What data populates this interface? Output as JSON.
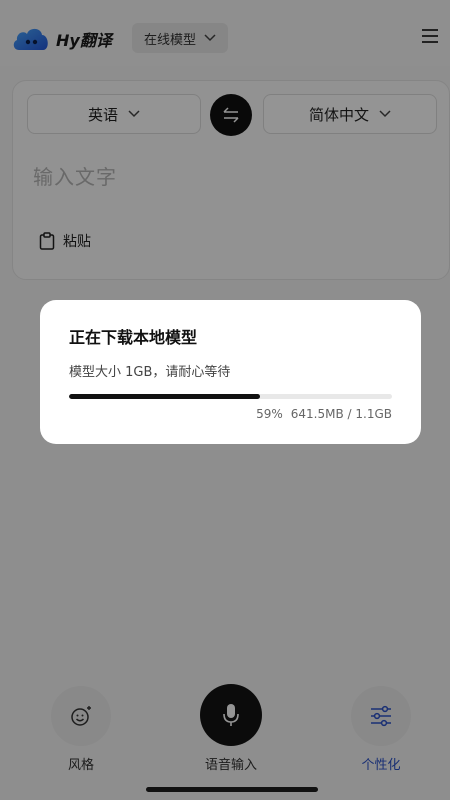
{
  "header": {
    "brand": "Hy翻译",
    "model_selector": "在线模型",
    "icons": {
      "logo": "cloud-logo-icon",
      "menu": "hamburger-menu-icon",
      "dropdown": "chevron-down-icon"
    }
  },
  "translator": {
    "source_lang": "英语",
    "target_lang": "简体中文",
    "swap_icon": "swap-arrows-icon",
    "input_placeholder": "输入文字",
    "paste_label": "粘贴",
    "paste_icon": "clipboard-icon"
  },
  "bottom_bar": {
    "items": [
      {
        "label": "风格",
        "icon": "smile-sparkle-icon"
      },
      {
        "label": "语音输入",
        "icon": "microphone-icon"
      },
      {
        "label": "个性化",
        "icon": "sliders-icon",
        "active": true
      }
    ],
    "active_color": "#2c52c9"
  },
  "download_dialog": {
    "title": "正在下载本地模型",
    "subtitle": "模型大小 1GB，请耐心等待",
    "progress_fraction": 0.59,
    "percent_text": "59%",
    "size_text": "641.5MB / 1.1GB"
  }
}
